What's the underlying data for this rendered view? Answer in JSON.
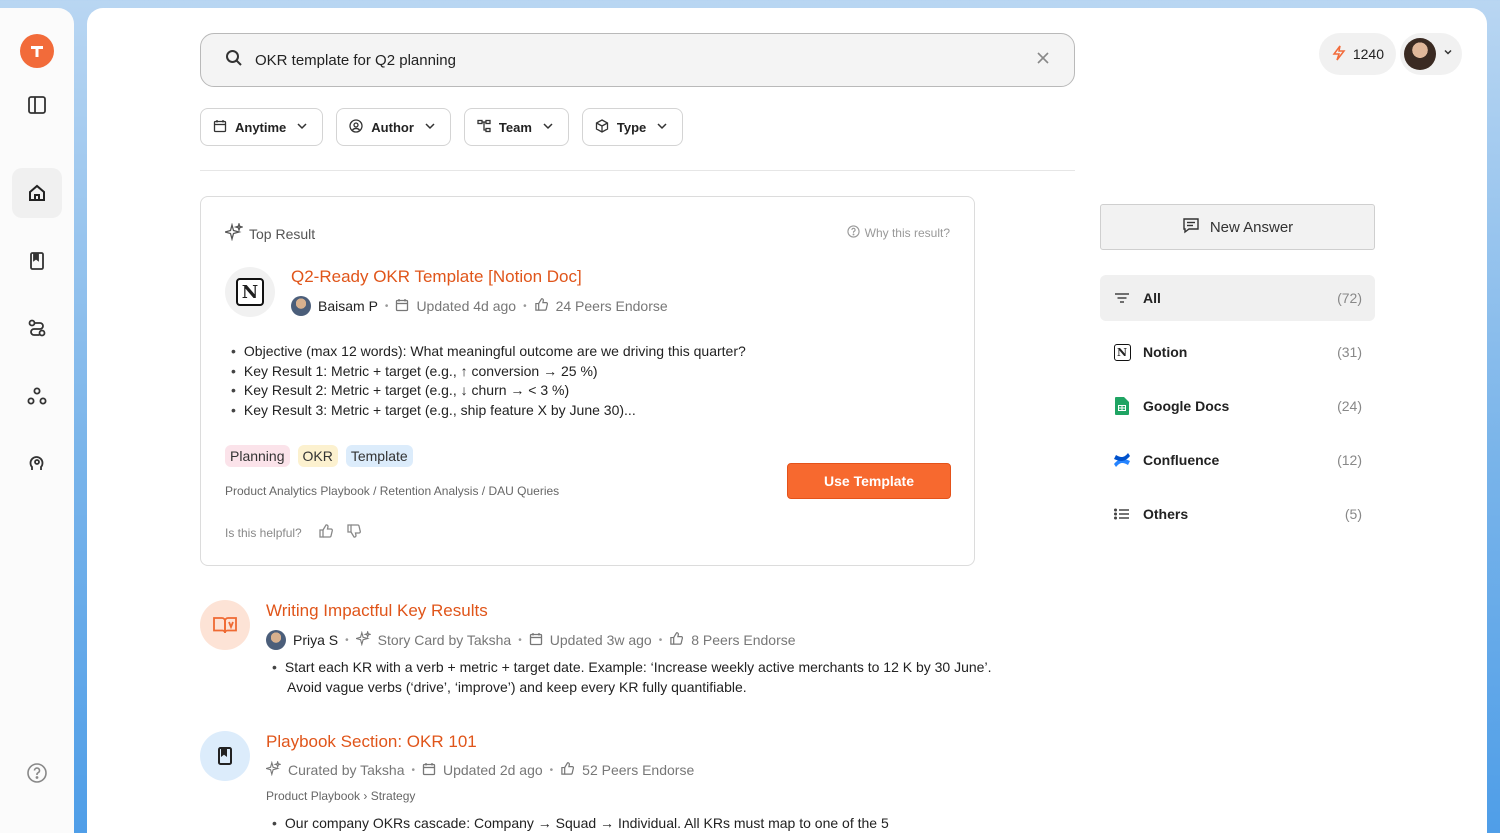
{
  "search": {
    "query": "OKR template for Q2 planning"
  },
  "filters": [
    {
      "label": "Anytime",
      "icon": "calendar-icon"
    },
    {
      "label": "Author",
      "icon": "user-circle-icon"
    },
    {
      "label": "Team",
      "icon": "team-icon"
    },
    {
      "label": "Type",
      "icon": "cube-icon"
    }
  ],
  "header": {
    "points": "1240"
  },
  "top_result": {
    "label": "Top Result",
    "why": "Why this result?",
    "title": "Q2-Ready OKR Template [Notion Doc]",
    "author": "Baisam P",
    "updated": "Updated 4d ago",
    "endorse": "24 Peers Endorse",
    "bullets": [
      "Objective (max 12 words): What meaningful outcome are we driving this quarter?",
      "Key Result 1: Metric + target (e.g., ↑ conversion → 25 %)",
      "Key Result 2: Metric + target (e.g., ↓ churn → < 3 %)",
      "Key Result 3: Metric + target (e.g., ship feature X by June 30)..."
    ],
    "tags": [
      "Planning",
      "OKR",
      "Template"
    ],
    "breadcrumb": "Product Analytics Playbook / Retention Analysis / DAU Queries",
    "action": "Use Template",
    "helpful": "Is this helpful?"
  },
  "results": [
    {
      "title": "Writing Impactful Key Results",
      "author": "Priya S",
      "source": "Story Card by Taksha",
      "updated": "Updated 3w ago",
      "endorse": "8 Peers Endorse",
      "text": "Start each KR with a verb + metric + target date. Example: ‘Increase weekly active merchants to 12 K by 30 June’. Avoid vague verbs (‘drive’, ‘improve’) and keep every KR fully quantifiable."
    },
    {
      "title": "Playbook Section: OKR 101",
      "source": "Curated by Taksha",
      "updated": "Updated 2d ago",
      "endorse": "52 Peers Endorse",
      "breadcrumb": "Product Playbook › Strategy",
      "text": "Our company OKRs cascade: Company → Squad → Individual. All KRs must map to one of the 5"
    }
  ],
  "sidebar_right": {
    "new_answer": "New Answer",
    "sources": [
      {
        "label": "All",
        "count": "(72)"
      },
      {
        "label": "Notion",
        "count": "(31)"
      },
      {
        "label": "Google Docs",
        "count": "(24)"
      },
      {
        "label": "Confluence",
        "count": "(12)"
      },
      {
        "label": "Others",
        "count": "(5)"
      }
    ]
  },
  "colors": {
    "accent": "#f7692f",
    "title": "#e0551a"
  }
}
